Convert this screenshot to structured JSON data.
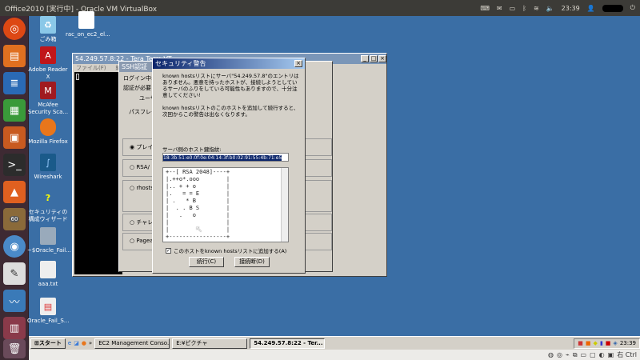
{
  "topbar": {
    "title": "Office2010 [実行中] - Oracle VM VirtualBox",
    "time": "23:39"
  },
  "desktop_icons": [
    {
      "label": "ごみ箱",
      "icon": "recycle-bin-icon"
    },
    {
      "label": "rac_on_ec2_el...",
      "icon": "document-icon"
    },
    {
      "label": "Adobe Reader X",
      "icon": "adobe-reader-icon"
    },
    {
      "label": "McAfee Security Sca...",
      "icon": "mcafee-icon"
    },
    {
      "label": "Mozilla Firefox",
      "icon": "firefox-icon"
    },
    {
      "label": "Wireshark",
      "icon": "wireshark-icon"
    },
    {
      "label": "セキュリティの構成ウィザード",
      "icon": "security-wizard-icon"
    },
    {
      "label": "~$Oracle_Fail...",
      "icon": "document-icon"
    },
    {
      "label": "aaa.txt",
      "icon": "text-file-icon"
    },
    {
      "label": "Oracle_Fail_S...",
      "icon": "document-icon"
    }
  ],
  "teraterm": {
    "title": "54.249.57.8:22 - Tera Term VT",
    "menu": [
      "ファイル(F)",
      "編集"
    ]
  },
  "ssh_auth": {
    "title": "SSH認証",
    "login": "ログイン中:",
    "auth_required": "認証が必要",
    "user": "ユーザ",
    "passphrase": "パスフレーズ",
    "options": [
      "プレイ",
      "RSA/",
      "rhosts",
      "チャレ",
      "Pagea"
    ]
  },
  "security_warning": {
    "title": "セキュリティ警告",
    "message1": "known hostsリストにサーバ\"54.249.57.8\"のエントリはありません。悪意を持ったホストが、接続しようとしているサーバのふりをしている可能性もありますので、十分注意してください!",
    "message2": "known hostsリストのこのホストを追加して続行すると、次回からこの警告は出なくなります。",
    "fingerprint_label": "サーバ側のホスト鍵指紋:",
    "fingerprint": "18:3b:51:e0:0f:0e:04:14:3f:b0:02:91:55:4b:71:e5",
    "randomart": "+--[ RSA 2048]----+\n|.++o*.ooo        |\n|.. + + o         |\n|.   = = E        |\n| .   * B         |\n|  . . B S        |\n|   .   o         |\n|                 |\n|                 |\n+-----------------+",
    "checkbox_label": "このホストをknown hostsリストに追加する(A)",
    "checkbox_checked": true,
    "continue": "続行(C)",
    "disconnect": "接続断(D)"
  },
  "taskbar": {
    "start": "スタート",
    "items": [
      "EC2 Management Conso...",
      "E:¥ピクチャ",
      "54.249.57.8:22 - Ter..."
    ],
    "time": "23:39"
  },
  "vbox_status": {
    "host_key": "右 Ctrl"
  },
  "launcher": {
    "badge": "60"
  }
}
